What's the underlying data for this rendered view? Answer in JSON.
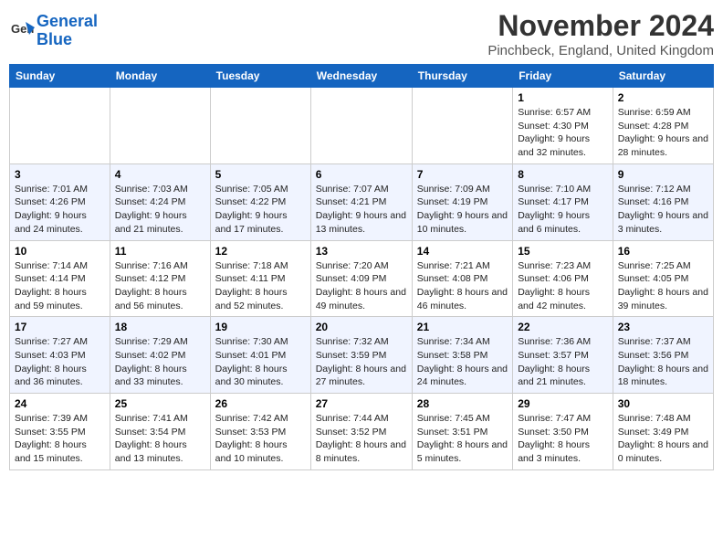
{
  "header": {
    "logo_line1": "General",
    "logo_line2": "Blue",
    "month_title": "November 2024",
    "location": "Pinchbeck, England, United Kingdom"
  },
  "days_of_week": [
    "Sunday",
    "Monday",
    "Tuesday",
    "Wednesday",
    "Thursday",
    "Friday",
    "Saturday"
  ],
  "weeks": [
    [
      {
        "num": "",
        "info": ""
      },
      {
        "num": "",
        "info": ""
      },
      {
        "num": "",
        "info": ""
      },
      {
        "num": "",
        "info": ""
      },
      {
        "num": "",
        "info": ""
      },
      {
        "num": "1",
        "info": "Sunrise: 6:57 AM\nSunset: 4:30 PM\nDaylight: 9 hours and 32 minutes."
      },
      {
        "num": "2",
        "info": "Sunrise: 6:59 AM\nSunset: 4:28 PM\nDaylight: 9 hours and 28 minutes."
      }
    ],
    [
      {
        "num": "3",
        "info": "Sunrise: 7:01 AM\nSunset: 4:26 PM\nDaylight: 9 hours and 24 minutes."
      },
      {
        "num": "4",
        "info": "Sunrise: 7:03 AM\nSunset: 4:24 PM\nDaylight: 9 hours and 21 minutes."
      },
      {
        "num": "5",
        "info": "Sunrise: 7:05 AM\nSunset: 4:22 PM\nDaylight: 9 hours and 17 minutes."
      },
      {
        "num": "6",
        "info": "Sunrise: 7:07 AM\nSunset: 4:21 PM\nDaylight: 9 hours and 13 minutes."
      },
      {
        "num": "7",
        "info": "Sunrise: 7:09 AM\nSunset: 4:19 PM\nDaylight: 9 hours and 10 minutes."
      },
      {
        "num": "8",
        "info": "Sunrise: 7:10 AM\nSunset: 4:17 PM\nDaylight: 9 hours and 6 minutes."
      },
      {
        "num": "9",
        "info": "Sunrise: 7:12 AM\nSunset: 4:16 PM\nDaylight: 9 hours and 3 minutes."
      }
    ],
    [
      {
        "num": "10",
        "info": "Sunrise: 7:14 AM\nSunset: 4:14 PM\nDaylight: 8 hours and 59 minutes."
      },
      {
        "num": "11",
        "info": "Sunrise: 7:16 AM\nSunset: 4:12 PM\nDaylight: 8 hours and 56 minutes."
      },
      {
        "num": "12",
        "info": "Sunrise: 7:18 AM\nSunset: 4:11 PM\nDaylight: 8 hours and 52 minutes."
      },
      {
        "num": "13",
        "info": "Sunrise: 7:20 AM\nSunset: 4:09 PM\nDaylight: 8 hours and 49 minutes."
      },
      {
        "num": "14",
        "info": "Sunrise: 7:21 AM\nSunset: 4:08 PM\nDaylight: 8 hours and 46 minutes."
      },
      {
        "num": "15",
        "info": "Sunrise: 7:23 AM\nSunset: 4:06 PM\nDaylight: 8 hours and 42 minutes."
      },
      {
        "num": "16",
        "info": "Sunrise: 7:25 AM\nSunset: 4:05 PM\nDaylight: 8 hours and 39 minutes."
      }
    ],
    [
      {
        "num": "17",
        "info": "Sunrise: 7:27 AM\nSunset: 4:03 PM\nDaylight: 8 hours and 36 minutes."
      },
      {
        "num": "18",
        "info": "Sunrise: 7:29 AM\nSunset: 4:02 PM\nDaylight: 8 hours and 33 minutes."
      },
      {
        "num": "19",
        "info": "Sunrise: 7:30 AM\nSunset: 4:01 PM\nDaylight: 8 hours and 30 minutes."
      },
      {
        "num": "20",
        "info": "Sunrise: 7:32 AM\nSunset: 3:59 PM\nDaylight: 8 hours and 27 minutes."
      },
      {
        "num": "21",
        "info": "Sunrise: 7:34 AM\nSunset: 3:58 PM\nDaylight: 8 hours and 24 minutes."
      },
      {
        "num": "22",
        "info": "Sunrise: 7:36 AM\nSunset: 3:57 PM\nDaylight: 8 hours and 21 minutes."
      },
      {
        "num": "23",
        "info": "Sunrise: 7:37 AM\nSunset: 3:56 PM\nDaylight: 8 hours and 18 minutes."
      }
    ],
    [
      {
        "num": "24",
        "info": "Sunrise: 7:39 AM\nSunset: 3:55 PM\nDaylight: 8 hours and 15 minutes."
      },
      {
        "num": "25",
        "info": "Sunrise: 7:41 AM\nSunset: 3:54 PM\nDaylight: 8 hours and 13 minutes."
      },
      {
        "num": "26",
        "info": "Sunrise: 7:42 AM\nSunset: 3:53 PM\nDaylight: 8 hours and 10 minutes."
      },
      {
        "num": "27",
        "info": "Sunrise: 7:44 AM\nSunset: 3:52 PM\nDaylight: 8 hours and 8 minutes."
      },
      {
        "num": "28",
        "info": "Sunrise: 7:45 AM\nSunset: 3:51 PM\nDaylight: 8 hours and 5 minutes."
      },
      {
        "num": "29",
        "info": "Sunrise: 7:47 AM\nSunset: 3:50 PM\nDaylight: 8 hours and 3 minutes."
      },
      {
        "num": "30",
        "info": "Sunrise: 7:48 AM\nSunset: 3:49 PM\nDaylight: 8 hours and 0 minutes."
      }
    ]
  ]
}
